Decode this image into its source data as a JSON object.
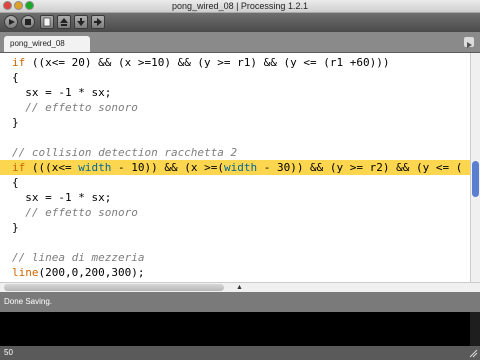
{
  "window": {
    "title": "pong_wired_08 | Processing 1.2.1"
  },
  "toolbar": {
    "buttons": [
      "run-icon",
      "stop-icon",
      "new-icon",
      "open-icon",
      "save-icon",
      "export-icon"
    ]
  },
  "tabs": [
    {
      "label": "pong_wired_08"
    }
  ],
  "editor": {
    "lines": [
      "if ((x<= 20) && (x >=10) && (y >= r1) && (y <= (r1 +60)))",
      "{",
      "  sx = -1 * sx;",
      "  // effetto sonoro",
      "}",
      "",
      "// collision detection racchetta 2",
      "if (((x<= width - 10)) && (x >=(width - 30)) && (y >= r2) && (y <= (",
      "{",
      "  sx = -1 * sx;",
      "  // effetto sonoro",
      "}",
      "",
      "// linea di mezzeria",
      "line(200,0,200,300);"
    ],
    "highlight_line": 8
  },
  "status": {
    "message": "Done Saving."
  },
  "footer": {
    "line_number": "50"
  },
  "colors": {
    "highlight": "#fdd650",
    "keyword": "#cc6600",
    "comment": "#7e7e7e",
    "constant": "#006699"
  }
}
